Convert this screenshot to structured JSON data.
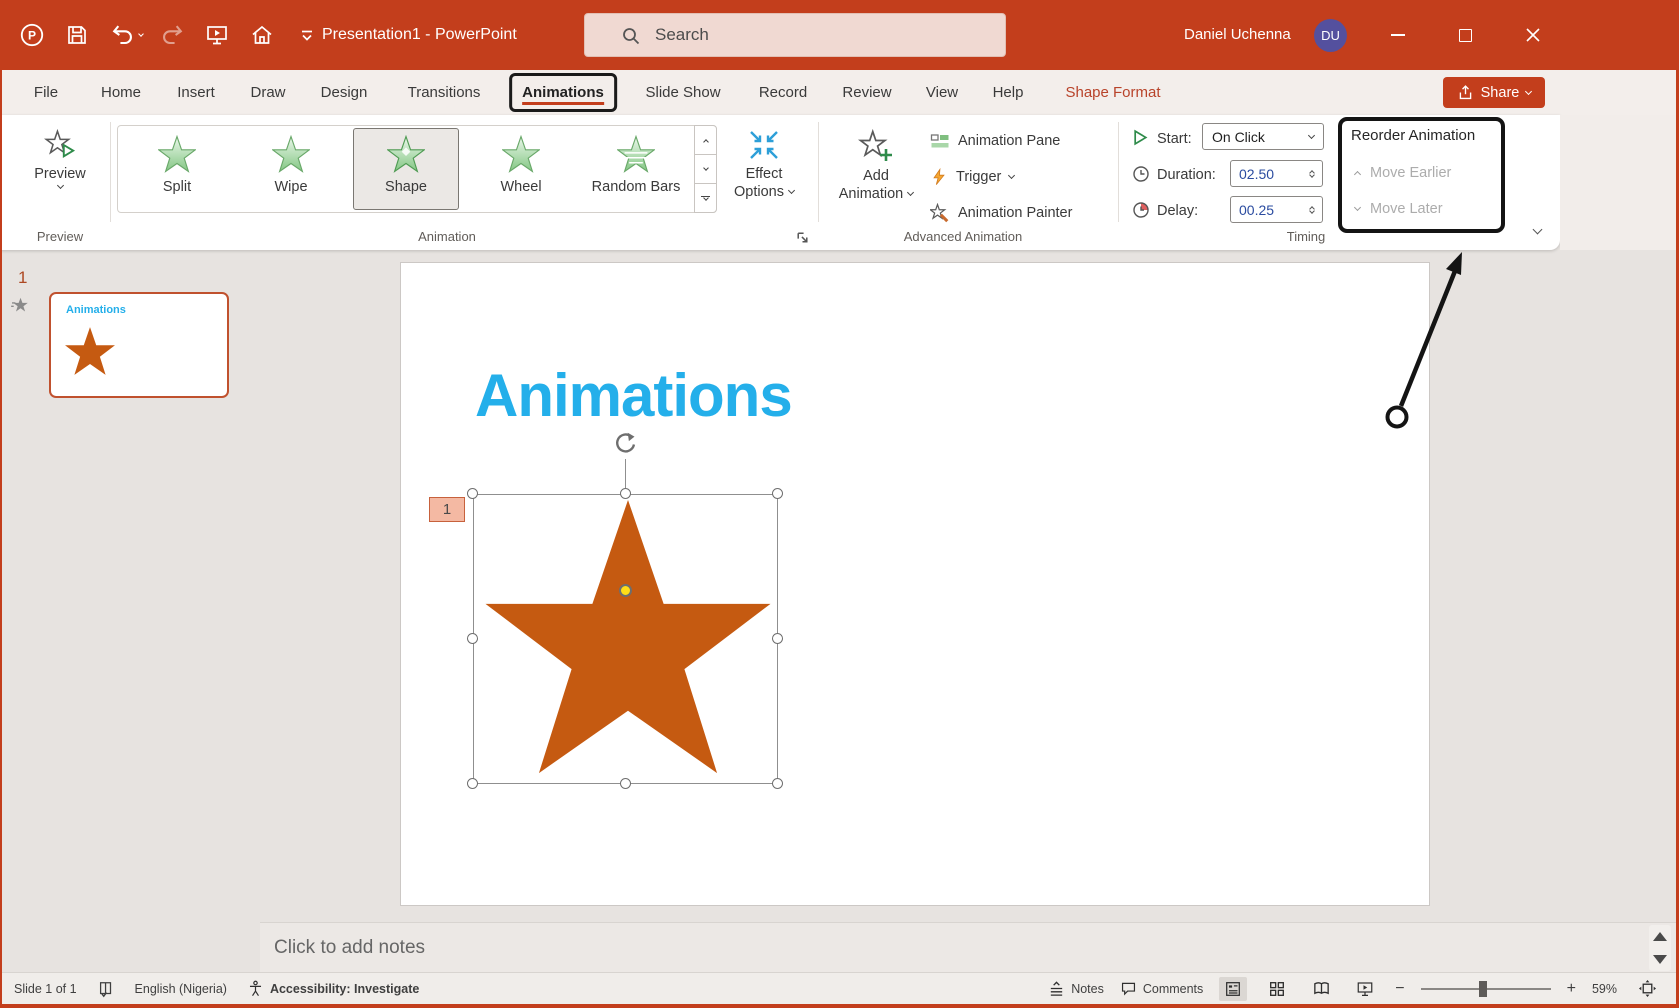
{
  "titlebar": {
    "title": "Presentation1  -  PowerPoint",
    "search_placeholder": "Search",
    "user_name": "Daniel Uchenna",
    "user_initials": "DU"
  },
  "tabs": {
    "items": [
      {
        "label": "File"
      },
      {
        "label": "Home"
      },
      {
        "label": "Insert"
      },
      {
        "label": "Draw"
      },
      {
        "label": "Design"
      },
      {
        "label": "Transitions"
      },
      {
        "label": "Animations",
        "active": true,
        "annotated": true
      },
      {
        "label": "Slide Show"
      },
      {
        "label": "Record"
      },
      {
        "label": "Review"
      },
      {
        "label": "View"
      },
      {
        "label": "Help"
      },
      {
        "label": "Shape Format",
        "contextual": true
      }
    ],
    "share_label": "Share"
  },
  "ribbon": {
    "preview": {
      "button": "Preview",
      "group": "Preview"
    },
    "animation": {
      "gallery": [
        "Split",
        "Wipe",
        "Shape",
        "Wheel",
        "Random Bars"
      ],
      "selected": "Shape",
      "effect_options_line1": "Effect",
      "effect_options_line2": "Options",
      "group": "Animation"
    },
    "advanced": {
      "add_line1": "Add",
      "add_line2": "Animation",
      "pane": "Animation Pane",
      "trigger": "Trigger",
      "painter": "Animation Painter",
      "group": "Advanced Animation"
    },
    "timing": {
      "start_label": "Start:",
      "start_value": "On Click",
      "duration_label": "Duration:",
      "duration_value": "02.50",
      "delay_label": "Delay:",
      "delay_value": "00.25",
      "group": "Timing"
    },
    "reorder": {
      "title": "Reorder Animation",
      "move_earlier": "Move Earlier",
      "move_later": "Move Later"
    }
  },
  "slides_panel": {
    "slide_number": "1",
    "thumb_title": "Animations"
  },
  "slide": {
    "title": "Animations",
    "animation_badge": "1"
  },
  "notes": {
    "placeholder": "Click to add notes"
  },
  "statusbar": {
    "slide_indicator": "Slide 1 of 1",
    "language": "English (Nigeria)",
    "accessibility": "Accessibility: Investigate",
    "notes": "Notes",
    "comments": "Comments",
    "zoom": "59%"
  },
  "annotations": {
    "boxed_tab": "Animations",
    "boxed_group": "Reorder Animation",
    "arrow": "points from slide area to Reorder Animation group"
  },
  "icons": {
    "app-logo": "powerpoint-circle-P",
    "save-icon": "floppy-disk",
    "undo-icon": "curved-arrow-left",
    "redo-icon": "curved-arrow-right-disabled",
    "start-slideshow-icon": "monitor-with-play",
    "home-icon": "house",
    "qat-customize-icon": "chevron-with-bar",
    "search-icon": "magnifier",
    "share-icon": "arrow-out-of-tray",
    "preview-icon": "star-with-play-triangle",
    "gallery-star-icon": "green-star",
    "effect-options-icon": "four-arrows-inward",
    "add-animation-icon": "star-with-plus",
    "animation-pane-icon": "list-bars",
    "trigger-icon": "lightning-bolt",
    "animation-painter-icon": "star-with-brush",
    "start-icon": "play-triangle-outline",
    "duration-icon": "clock",
    "delay-icon": "clock-red-quarter",
    "dialog-launcher-icon": "corner-arrow",
    "collapse-ribbon-icon": "chevron-down",
    "rotation-handle-icon": "circular-arrow",
    "slide-animation-indicator-icon": "star-with-motion-lines",
    "spellcheck-icon": "book-with-check",
    "accessibility-icon": "person-figure",
    "notes-icon": "lines-with-caret",
    "comments-icon": "speech-bubble",
    "view-normal-icon": "document-panels",
    "view-sorter-icon": "grid-squares",
    "view-reading-icon": "open-book",
    "view-slideshow-icon": "monitor-stand",
    "zoom-out-icon": "minus",
    "zoom-in-icon": "plus",
    "fit-to-window-icon": "expand-arrows"
  },
  "colors": {
    "titlebar_red": "#C33E1C",
    "title_blue": "#24AFEA",
    "star_orange": "#C55A11",
    "avatar_purple": "#54509E",
    "thumb_border": "#C0512E",
    "green_star": "#84C784",
    "disabled_text": "#ACACAC",
    "annotation_black": "#141414",
    "spin_value_blue": "#2B4CA0"
  }
}
